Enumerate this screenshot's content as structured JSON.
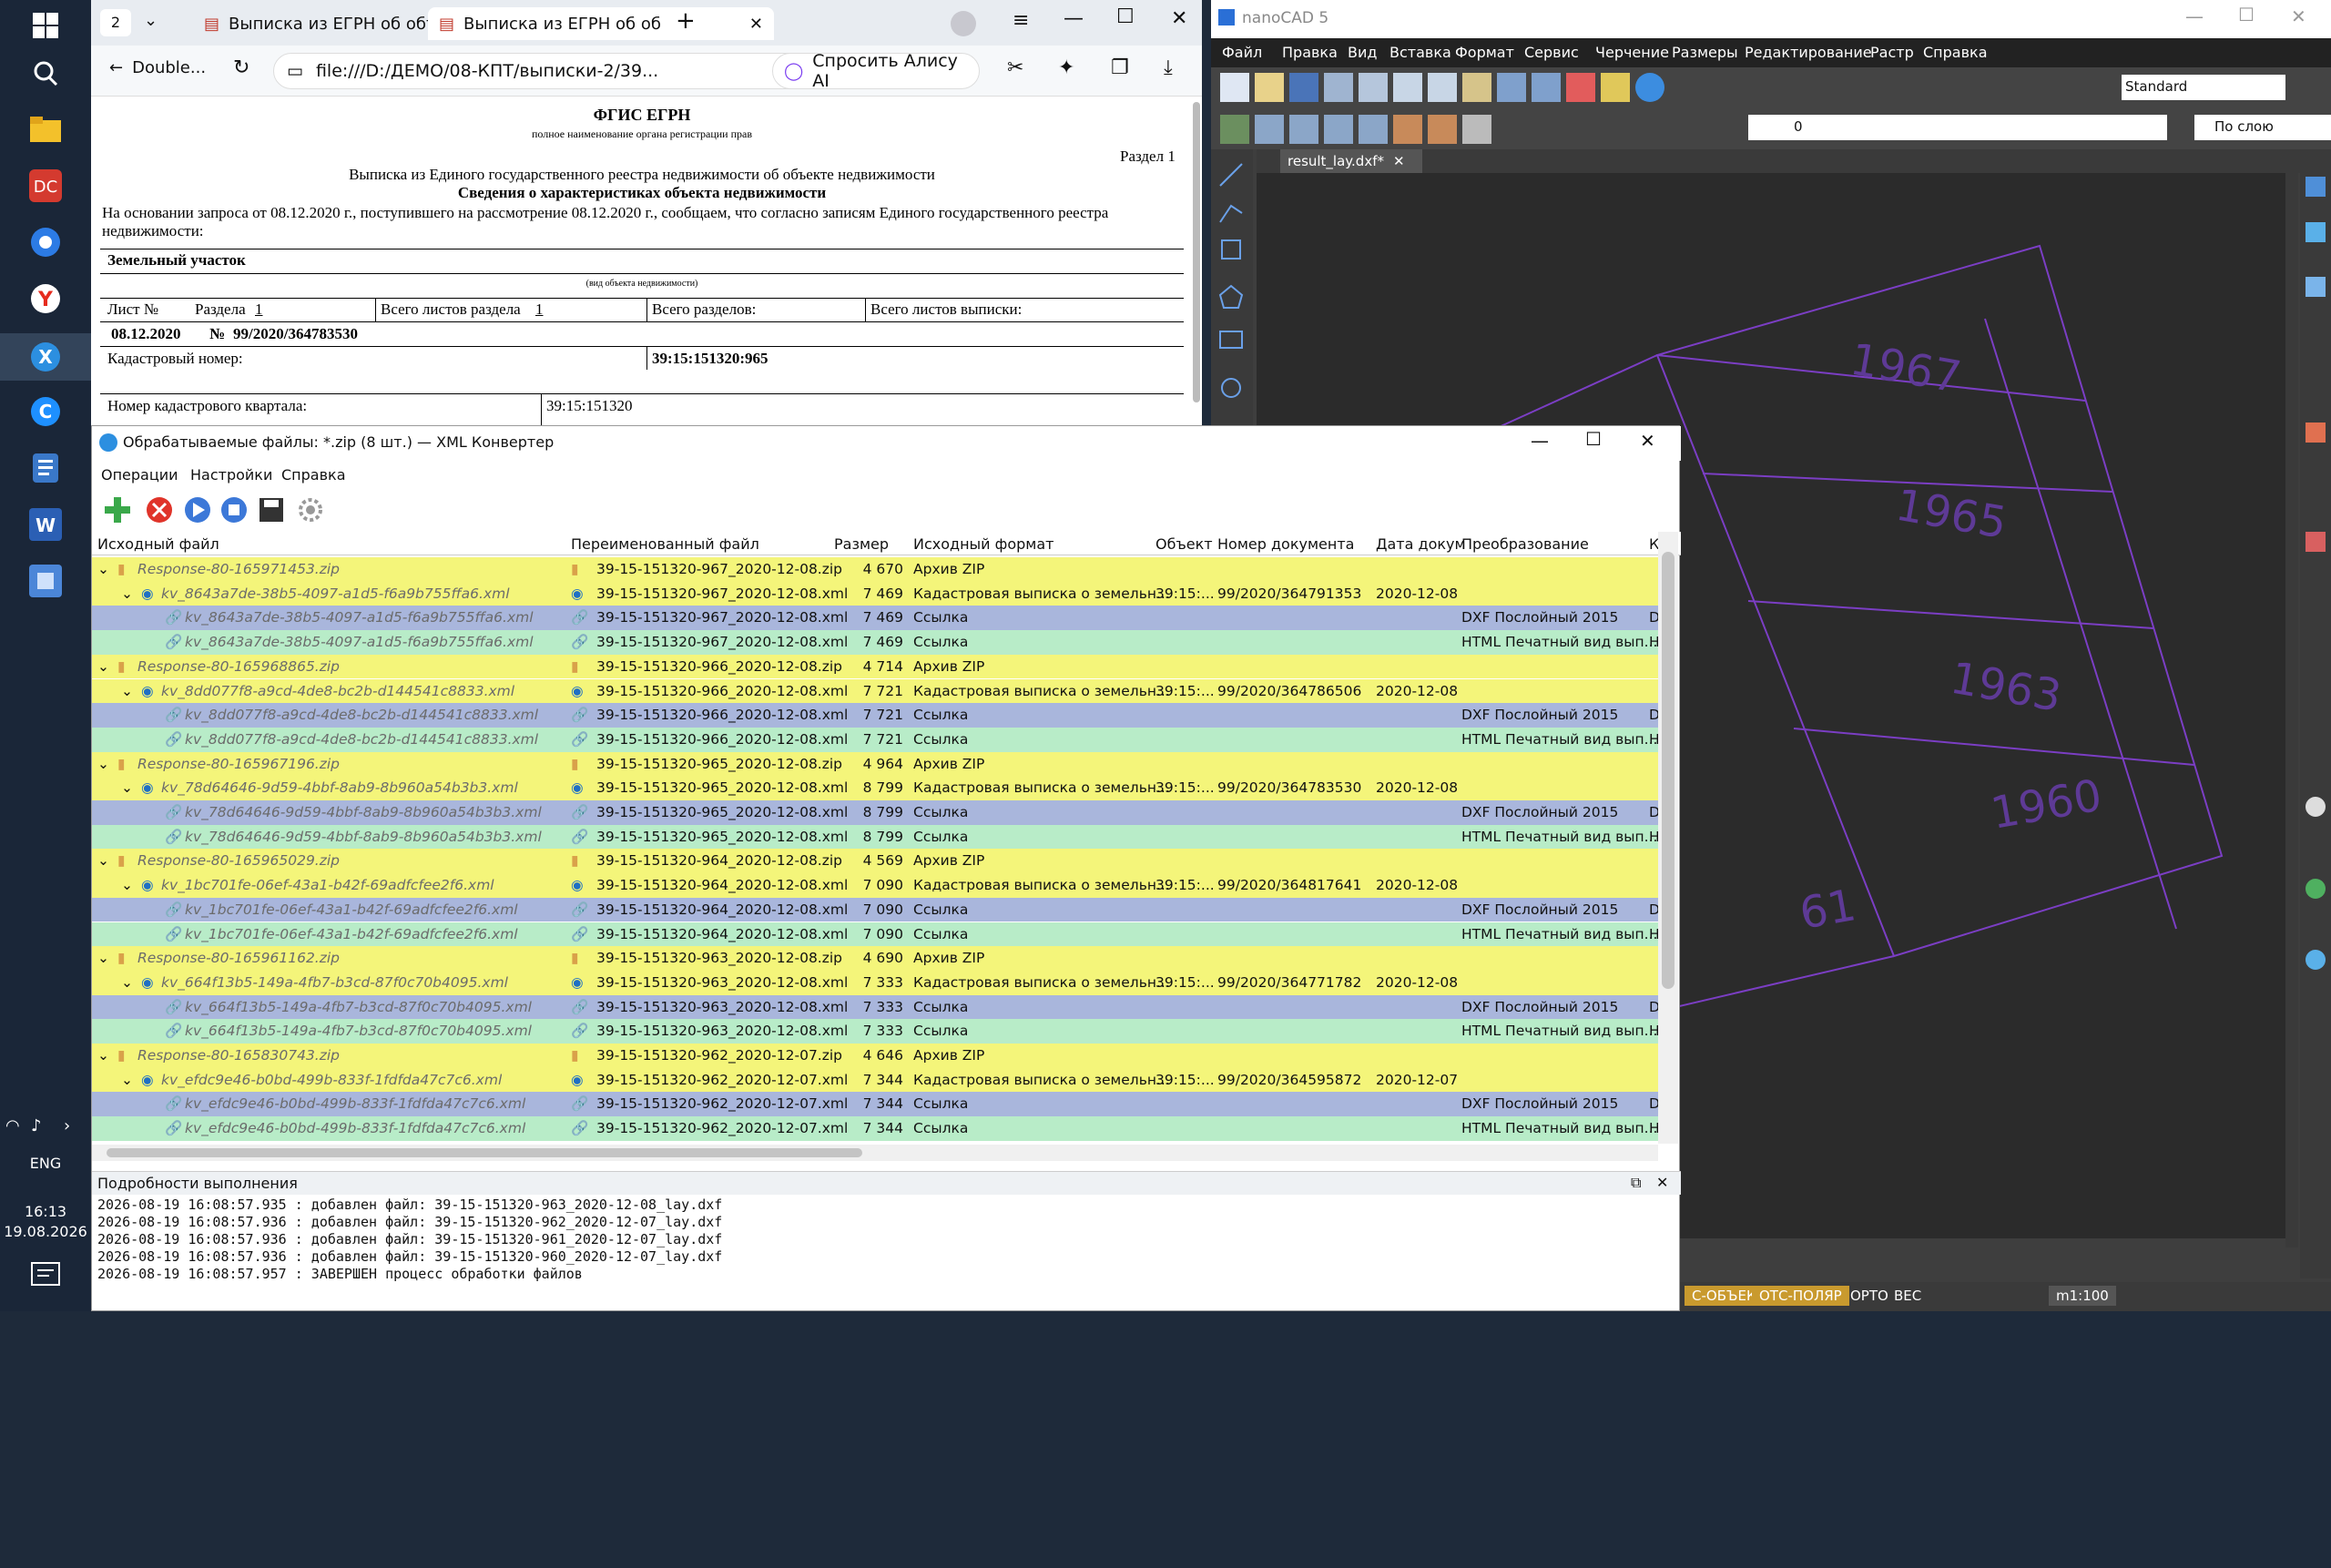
{
  "taskbar": {
    "lang": "ENG",
    "time": "16:13",
    "date": "19.08.2026"
  },
  "browser": {
    "tab_count": "2",
    "tabs": [
      {
        "title": "Выписка из ЕГРН об объе"
      },
      {
        "title": "Выписка из ЕГРН об об"
      }
    ],
    "back_label": "Double...",
    "address": "file:///D:/ДЕМО/08-КПТ/выписки-2/39...",
    "ask_alice": "Спросить Алису AI",
    "document": {
      "header": "ФГИС ЕГРН",
      "subheader": "полное наименование органа регистрации прав",
      "section": "Раздел 1",
      "title1": "Выписка из Единого государственного реестра недвижимости об объекте недвижимости",
      "title2": "Сведения о характеристиках объекта недвижимости",
      "para1": "На основании запроса от 08.12.2020 г., поступившего на рассмотрение 08.12.2020 г., сообщаем, что согласно записям Единого государственного реестра",
      "para2": "недвижимости:",
      "object_type": "Земельный участок",
      "object_type_caption": "(вид объекта недвижимости)",
      "sheet_no": "Лист №",
      "sheet_section": "Раздела",
      "sheet_section_val": "1",
      "total_sheets_section": "Всего листов раздела",
      "total_sheets_section_val": "1",
      "total_sections": "Всего разделов:",
      "total_sheets": "Всего листов выписки:",
      "date": "08.12.2020",
      "num_label": "№",
      "doc_number": "99/2020/364783530",
      "cad_label": "Кадастровый номер:",
      "cad_value": "39:15:151320:965",
      "quarter_label": "Номер кадастрового квартала:",
      "quarter_value": "39:15:151320"
    }
  },
  "nanocad": {
    "title": "nanoCAD 5",
    "menu": [
      "Файл",
      "Правка",
      "Вид",
      "Вставка",
      "Формат",
      "Сервис",
      "Черчение",
      "Размеры",
      "Редактирование",
      "Растр",
      "Справка"
    ],
    "style_value": "Standard",
    "layer_value": "0",
    "linetype_value": "По слою",
    "doc_tab": "result_lay.dxf*",
    "parcels": [
      "1967",
      "1965",
      "1963",
      "1960",
      "61"
    ],
    "status": [
      "С-ОБЪЕКТ",
      "ОТС-ПОЛЯР",
      "ОРТО",
      "ВЕС"
    ],
    "scale": "m1:100"
  },
  "converter": {
    "title": "Обрабатываемые файлы: *.zip (8 шт.) — XML Конвертер",
    "menu": [
      "Операции",
      "Настройки",
      "Справка"
    ],
    "columns": [
      "Исходный файл",
      "Переименованный файл",
      "Размер",
      "Исходный формат",
      "Объект",
      "Номер документа",
      "Дата докум",
      "Преобразование",
      "К"
    ],
    "rows": [
      {
        "kind": "zip",
        "src": "Response-80-165971453.zip",
        "ren": "39-15-151320-967_2020-12-08.zip",
        "size": "4 670",
        "fmt": "Архив ZIP",
        "obj": "",
        "doc": "",
        "date": "",
        "conv": "",
        "k": ""
      },
      {
        "kind": "xml",
        "src": "kv_8643a7de-38b5-4097-a1d5-f6a9b755ffa6.xml",
        "ren": "39-15-151320-967_2020-12-08.xml",
        "size": "7 469",
        "fmt": "Кадастровая выписка о земельн...",
        "obj": "39:15:...",
        "doc": "99/2020/364791353",
        "date": "2020-12-08",
        "conv": "",
        "k": ""
      },
      {
        "kind": "dxf",
        "src": "kv_8643a7de-38b5-4097-a1d5-f6a9b755ffa6.xml",
        "ren": "39-15-151320-967_2020-12-08.xml",
        "size": "7 469",
        "fmt": "Ссылка",
        "obj": "",
        "doc": "",
        "date": "",
        "conv": "DXF Послойный 2015",
        "k": "D"
      },
      {
        "kind": "html",
        "src": "kv_8643a7de-38b5-4097-a1d5-f6a9b755ffa6.xml",
        "ren": "39-15-151320-967_2020-12-08.xml",
        "size": "7 469",
        "fmt": "Ссылка",
        "obj": "",
        "doc": "",
        "date": "",
        "conv": "HTML Печатный вид вып...",
        "k": "H"
      },
      {
        "kind": "zip",
        "src": "Response-80-165968865.zip",
        "ren": "39-15-151320-966_2020-12-08.zip",
        "size": "4 714",
        "fmt": "Архив ZIP",
        "obj": "",
        "doc": "",
        "date": "",
        "conv": "",
        "k": ""
      },
      {
        "kind": "xml",
        "src": "kv_8dd077f8-a9cd-4de8-bc2b-d144541c8833.xml",
        "ren": "39-15-151320-966_2020-12-08.xml",
        "size": "7 721",
        "fmt": "Кадастровая выписка о земельн...",
        "obj": "39:15:...",
        "doc": "99/2020/364786506",
        "date": "2020-12-08",
        "conv": "",
        "k": ""
      },
      {
        "kind": "dxf",
        "src": "kv_8dd077f8-a9cd-4de8-bc2b-d144541c8833.xml",
        "ren": "39-15-151320-966_2020-12-08.xml",
        "size": "7 721",
        "fmt": "Ссылка",
        "obj": "",
        "doc": "",
        "date": "",
        "conv": "DXF Послойный 2015",
        "k": "D"
      },
      {
        "kind": "html",
        "src": "kv_8dd077f8-a9cd-4de8-bc2b-d144541c8833.xml",
        "ren": "39-15-151320-966_2020-12-08.xml",
        "size": "7 721",
        "fmt": "Ссылка",
        "obj": "",
        "doc": "",
        "date": "",
        "conv": "HTML Печатный вид вып...",
        "k": "H"
      },
      {
        "kind": "zip",
        "src": "Response-80-165967196.zip",
        "ren": "39-15-151320-965_2020-12-08.zip",
        "size": "4 964",
        "fmt": "Архив ZIP",
        "obj": "",
        "doc": "",
        "date": "",
        "conv": "",
        "k": ""
      },
      {
        "kind": "xml",
        "src": "kv_78d64646-9d59-4bbf-8ab9-8b960a54b3b3.xml",
        "ren": "39-15-151320-965_2020-12-08.xml",
        "size": "8 799",
        "fmt": "Кадастровая выписка о земельн...",
        "obj": "39:15:...",
        "doc": "99/2020/364783530",
        "date": "2020-12-08",
        "conv": "",
        "k": ""
      },
      {
        "kind": "dxf",
        "src": "kv_78d64646-9d59-4bbf-8ab9-8b960a54b3b3.xml",
        "ren": "39-15-151320-965_2020-12-08.xml",
        "size": "8 799",
        "fmt": "Ссылка",
        "obj": "",
        "doc": "",
        "date": "",
        "conv": "DXF Послойный 2015",
        "k": "D"
      },
      {
        "kind": "html",
        "src": "kv_78d64646-9d59-4bbf-8ab9-8b960a54b3b3.xml",
        "ren": "39-15-151320-965_2020-12-08.xml",
        "size": "8 799",
        "fmt": "Ссылка",
        "obj": "",
        "doc": "",
        "date": "",
        "conv": "HTML Печатный вид вып...",
        "k": "H"
      },
      {
        "kind": "zip",
        "src": "Response-80-165965029.zip",
        "ren": "39-15-151320-964_2020-12-08.zip",
        "size": "4 569",
        "fmt": "Архив ZIP",
        "obj": "",
        "doc": "",
        "date": "",
        "conv": "",
        "k": ""
      },
      {
        "kind": "xml",
        "src": "kv_1bc701fe-06ef-43a1-b42f-69adfcfee2f6.xml",
        "ren": "39-15-151320-964_2020-12-08.xml",
        "size": "7 090",
        "fmt": "Кадастровая выписка о земельн...",
        "obj": "39:15:...",
        "doc": "99/2020/364817641",
        "date": "2020-12-08",
        "conv": "",
        "k": ""
      },
      {
        "kind": "dxf",
        "src": "kv_1bc701fe-06ef-43a1-b42f-69adfcfee2f6.xml",
        "ren": "39-15-151320-964_2020-12-08.xml",
        "size": "7 090",
        "fmt": "Ссылка",
        "obj": "",
        "doc": "",
        "date": "",
        "conv": "DXF Послойный 2015",
        "k": "D"
      },
      {
        "kind": "html",
        "src": "kv_1bc701fe-06ef-43a1-b42f-69adfcfee2f6.xml",
        "ren": "39-15-151320-964_2020-12-08.xml",
        "size": "7 090",
        "fmt": "Ссылка",
        "obj": "",
        "doc": "",
        "date": "",
        "conv": "HTML Печатный вид вып...",
        "k": "H"
      },
      {
        "kind": "zip",
        "src": "Response-80-165961162.zip",
        "ren": "39-15-151320-963_2020-12-08.zip",
        "size": "4 690",
        "fmt": "Архив ZIP",
        "obj": "",
        "doc": "",
        "date": "",
        "conv": "",
        "k": ""
      },
      {
        "kind": "xml",
        "src": "kv_664f13b5-149a-4fb7-b3cd-87f0c70b4095.xml",
        "ren": "39-15-151320-963_2020-12-08.xml",
        "size": "7 333",
        "fmt": "Кадастровая выписка о земельн...",
        "obj": "39:15:...",
        "doc": "99/2020/364771782",
        "date": "2020-12-08",
        "conv": "",
        "k": ""
      },
      {
        "kind": "dxf",
        "src": "kv_664f13b5-149a-4fb7-b3cd-87f0c70b4095.xml",
        "ren": "39-15-151320-963_2020-12-08.xml",
        "size": "7 333",
        "fmt": "Ссылка",
        "obj": "",
        "doc": "",
        "date": "",
        "conv": "DXF Послойный 2015",
        "k": "D"
      },
      {
        "kind": "html",
        "src": "kv_664f13b5-149a-4fb7-b3cd-87f0c70b4095.xml",
        "ren": "39-15-151320-963_2020-12-08.xml",
        "size": "7 333",
        "fmt": "Ссылка",
        "obj": "",
        "doc": "",
        "date": "",
        "conv": "HTML Печатный вид вып...",
        "k": "H"
      },
      {
        "kind": "zip",
        "src": "Response-80-165830743.zip",
        "ren": "39-15-151320-962_2020-12-07.zip",
        "size": "4 646",
        "fmt": "Архив ZIP",
        "obj": "",
        "doc": "",
        "date": "",
        "conv": "",
        "k": ""
      },
      {
        "kind": "xml",
        "src": "kv_efdc9e46-b0bd-499b-833f-1fdfda47c7c6.xml",
        "ren": "39-15-151320-962_2020-12-07.xml",
        "size": "7 344",
        "fmt": "Кадастровая выписка о земельн...",
        "obj": "39:15:...",
        "doc": "99/2020/364595872",
        "date": "2020-12-07",
        "conv": "",
        "k": ""
      },
      {
        "kind": "dxf",
        "src": "kv_efdc9e46-b0bd-499b-833f-1fdfda47c7c6.xml",
        "ren": "39-15-151320-962_2020-12-07.xml",
        "size": "7 344",
        "fmt": "Ссылка",
        "obj": "",
        "doc": "",
        "date": "",
        "conv": "DXF Послойный 2015",
        "k": "D"
      },
      {
        "kind": "html",
        "src": "kv_efdc9e46-b0bd-499b-833f-1fdfda47c7c6.xml",
        "ren": "39-15-151320-962_2020-12-07.xml",
        "size": "7 344",
        "fmt": "Ссылка",
        "obj": "",
        "doc": "",
        "date": "",
        "conv": "HTML Печатный вид вып...",
        "k": "H"
      }
    ],
    "log_title": "Подробности выполнения",
    "log": [
      "2026-08-19 16:08:57.935 : добавлен файл: 39-15-151320-963_2020-12-08_lay.dxf",
      "2026-08-19 16:08:57.936 : добавлен файл: 39-15-151320-962_2020-12-07_lay.dxf",
      "2026-08-19 16:08:57.936 : добавлен файл: 39-15-151320-961_2020-12-07_lay.dxf",
      "2026-08-19 16:08:57.936 : добавлен файл: 39-15-151320-960_2020-12-07_lay.dxf",
      "2026-08-19 16:08:57.957 : ЗАВЕРШЕН процесс обработки файлов"
    ]
  }
}
